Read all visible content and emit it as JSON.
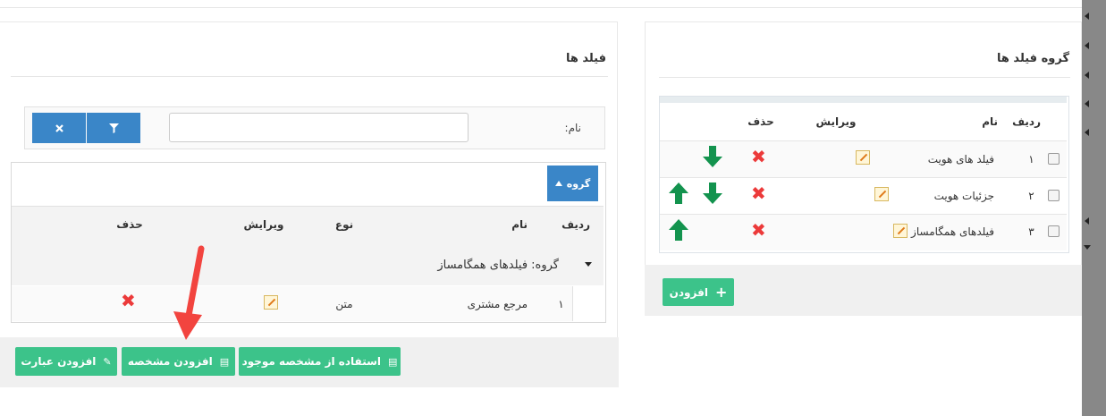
{
  "left_panel": {
    "title": "فیلد ها",
    "filter": {
      "name_label": "نام:",
      "name_value": "",
      "filter_btn": "filter-icon",
      "clear_btn": "close-icon"
    },
    "group_tab": "گروه",
    "table": {
      "columns": {
        "row": "ردیف",
        "name": "نام",
        "type": "نوع",
        "edit": "ویرایش",
        "delete": "حذف"
      },
      "group_label": "گروه: فیلدهای همگامساز",
      "rows": [
        {
          "row": "۱",
          "name": "مرجع مشتری",
          "type": "متن"
        }
      ]
    },
    "buttons": {
      "use_existing": "استفاده از مشخصه موجود",
      "add_attribute": "افزودن مشخصه",
      "add_expression": "افزودن عبارت"
    }
  },
  "right_panel": {
    "title": "گروه فیلد ها",
    "table": {
      "columns": {
        "row": "ردیف",
        "name": "نام",
        "edit": "ویرایش",
        "delete": "حذف"
      },
      "rows": [
        {
          "row": "۱",
          "name": "فیلد های هویت",
          "up": false,
          "down": true
        },
        {
          "row": "۲",
          "name": "جزئیات هویت",
          "up": true,
          "down": true
        },
        {
          "row": "۳",
          "name": "فیلدهای همگامساز",
          "up": true,
          "down": false
        }
      ]
    },
    "add_button": "افزودن"
  },
  "colors": {
    "green": "#3cc38a",
    "blue": "#3a86c8",
    "red": "#ec3a3a",
    "arrow_green": "#13934e",
    "annotation_red": "#f2443f"
  }
}
